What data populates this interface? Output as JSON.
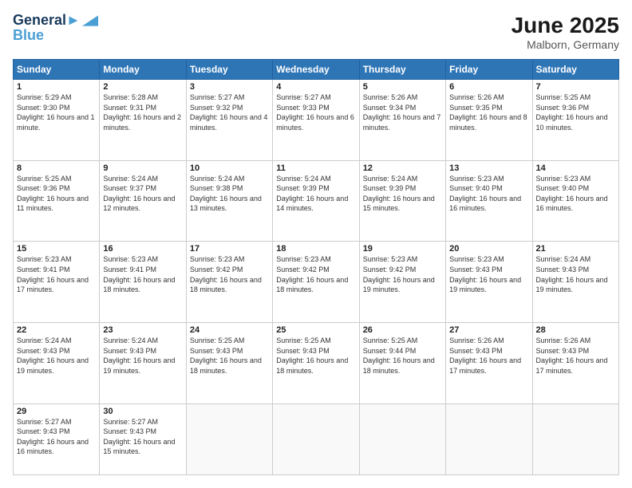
{
  "header": {
    "logo_line1": "General",
    "logo_line2": "Blue",
    "month": "June 2025",
    "location": "Malborn, Germany"
  },
  "days_of_week": [
    "Sunday",
    "Monday",
    "Tuesday",
    "Wednesday",
    "Thursday",
    "Friday",
    "Saturday"
  ],
  "weeks": [
    [
      {
        "day": "1",
        "sunrise": "5:29 AM",
        "sunset": "9:30 PM",
        "daylight": "16 hours and 1 minute."
      },
      {
        "day": "2",
        "sunrise": "5:28 AM",
        "sunset": "9:31 PM",
        "daylight": "16 hours and 2 minutes."
      },
      {
        "day": "3",
        "sunrise": "5:27 AM",
        "sunset": "9:32 PM",
        "daylight": "16 hours and 4 minutes."
      },
      {
        "day": "4",
        "sunrise": "5:27 AM",
        "sunset": "9:33 PM",
        "daylight": "16 hours and 6 minutes."
      },
      {
        "day": "5",
        "sunrise": "5:26 AM",
        "sunset": "9:34 PM",
        "daylight": "16 hours and 7 minutes."
      },
      {
        "day": "6",
        "sunrise": "5:26 AM",
        "sunset": "9:35 PM",
        "daylight": "16 hours and 8 minutes."
      },
      {
        "day": "7",
        "sunrise": "5:25 AM",
        "sunset": "9:36 PM",
        "daylight": "16 hours and 10 minutes."
      }
    ],
    [
      {
        "day": "8",
        "sunrise": "5:25 AM",
        "sunset": "9:36 PM",
        "daylight": "16 hours and 11 minutes."
      },
      {
        "day": "9",
        "sunrise": "5:24 AM",
        "sunset": "9:37 PM",
        "daylight": "16 hours and 12 minutes."
      },
      {
        "day": "10",
        "sunrise": "5:24 AM",
        "sunset": "9:38 PM",
        "daylight": "16 hours and 13 minutes."
      },
      {
        "day": "11",
        "sunrise": "5:24 AM",
        "sunset": "9:39 PM",
        "daylight": "16 hours and 14 minutes."
      },
      {
        "day": "12",
        "sunrise": "5:24 AM",
        "sunset": "9:39 PM",
        "daylight": "16 hours and 15 minutes."
      },
      {
        "day": "13",
        "sunrise": "5:23 AM",
        "sunset": "9:40 PM",
        "daylight": "16 hours and 16 minutes."
      },
      {
        "day": "14",
        "sunrise": "5:23 AM",
        "sunset": "9:40 PM",
        "daylight": "16 hours and 16 minutes."
      }
    ],
    [
      {
        "day": "15",
        "sunrise": "5:23 AM",
        "sunset": "9:41 PM",
        "daylight": "16 hours and 17 minutes."
      },
      {
        "day": "16",
        "sunrise": "5:23 AM",
        "sunset": "9:41 PM",
        "daylight": "16 hours and 18 minutes."
      },
      {
        "day": "17",
        "sunrise": "5:23 AM",
        "sunset": "9:42 PM",
        "daylight": "16 hours and 18 minutes."
      },
      {
        "day": "18",
        "sunrise": "5:23 AM",
        "sunset": "9:42 PM",
        "daylight": "16 hours and 18 minutes."
      },
      {
        "day": "19",
        "sunrise": "5:23 AM",
        "sunset": "9:42 PM",
        "daylight": "16 hours and 19 minutes."
      },
      {
        "day": "20",
        "sunrise": "5:23 AM",
        "sunset": "9:43 PM",
        "daylight": "16 hours and 19 minutes."
      },
      {
        "day": "21",
        "sunrise": "5:24 AM",
        "sunset": "9:43 PM",
        "daylight": "16 hours and 19 minutes."
      }
    ],
    [
      {
        "day": "22",
        "sunrise": "5:24 AM",
        "sunset": "9:43 PM",
        "daylight": "16 hours and 19 minutes."
      },
      {
        "day": "23",
        "sunrise": "5:24 AM",
        "sunset": "9:43 PM",
        "daylight": "16 hours and 19 minutes."
      },
      {
        "day": "24",
        "sunrise": "5:25 AM",
        "sunset": "9:43 PM",
        "daylight": "16 hours and 18 minutes."
      },
      {
        "day": "25",
        "sunrise": "5:25 AM",
        "sunset": "9:43 PM",
        "daylight": "16 hours and 18 minutes."
      },
      {
        "day": "26",
        "sunrise": "5:25 AM",
        "sunset": "9:44 PM",
        "daylight": "16 hours and 18 minutes."
      },
      {
        "day": "27",
        "sunrise": "5:26 AM",
        "sunset": "9:43 PM",
        "daylight": "16 hours and 17 minutes."
      },
      {
        "day": "28",
        "sunrise": "5:26 AM",
        "sunset": "9:43 PM",
        "daylight": "16 hours and 17 minutes."
      }
    ],
    [
      {
        "day": "29",
        "sunrise": "5:27 AM",
        "sunset": "9:43 PM",
        "daylight": "16 hours and 16 minutes."
      },
      {
        "day": "30",
        "sunrise": "5:27 AM",
        "sunset": "9:43 PM",
        "daylight": "16 hours and 15 minutes."
      },
      null,
      null,
      null,
      null,
      null
    ]
  ]
}
